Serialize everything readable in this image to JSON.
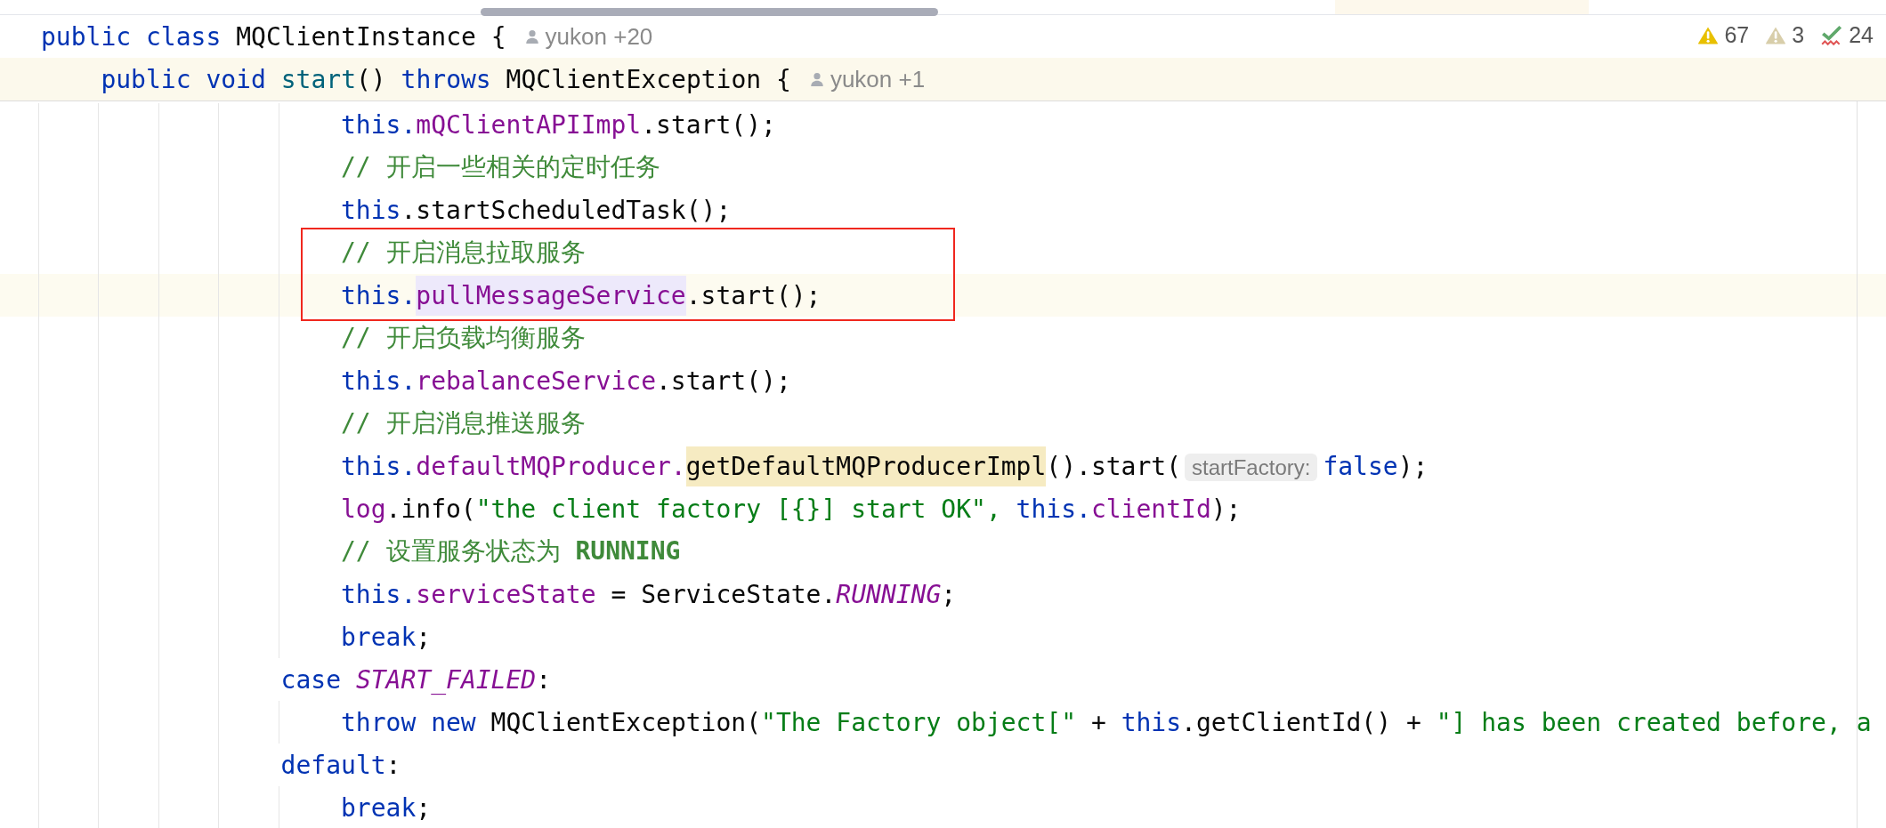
{
  "sticky_lines": [
    {
      "current": false,
      "tokens": [
        {
          "t": "public ",
          "kind": "keyword"
        },
        {
          "t": "class ",
          "kind": "keyword"
        },
        {
          "t": "MQClientInstance {",
          "kind": "plain"
        }
      ],
      "author": "yukon +20"
    },
    {
      "current": true,
      "tokens": [
        {
          "t": "public ",
          "kind": "keyword"
        },
        {
          "t": "void ",
          "kind": "keyword"
        },
        {
          "t": "start",
          "kind": "method"
        },
        {
          "t": "() ",
          "kind": "plain"
        },
        {
          "t": "throws ",
          "kind": "keyword"
        },
        {
          "t": "MQClientException {",
          "kind": "plain"
        }
      ],
      "author": "yukon +1"
    }
  ],
  "inspections": [
    {
      "kind": "warning",
      "count": "67"
    },
    {
      "kind": "weak-warning",
      "count": "3"
    },
    {
      "kind": "typo",
      "count": "24"
    }
  ],
  "code": [
    {
      "children": [
        {
          "current": false,
          "tokens": [
            {
              "t": "this.",
              "kind": "keyword"
            },
            {
              "t": "mQClientAPIImpl",
              "kind": "field"
            },
            {
              "t": ".start();",
              "kind": "plain"
            }
          ]
        },
        {
          "current": false,
          "tokens": [
            {
              "t": "// 开启一些相关的定时任务",
              "kind": "comment"
            }
          ]
        },
        {
          "current": false,
          "tokens": [
            {
              "t": "this",
              "kind": "keyword"
            },
            {
              "t": ".startScheduledTask();",
              "kind": "plain"
            }
          ]
        },
        {
          "kind": "frame",
          "lines": [
            {
              "current": false,
              "tokens": [
                {
                  "t": "// 开启消息拉取服务",
                  "kind": "comment"
                }
              ]
            },
            {
              "current": true,
              "tokens": [
                {
                  "t": "this.",
                  "kind": "keyword"
                },
                {
                  "t": "pullMessageService",
                  "kind": "usage"
                },
                {
                  "t": ".start();",
                  "kind": "plain"
                }
              ]
            }
          ]
        },
        {
          "current": false,
          "tokens": [
            {
              "t": "// 开启负载均衡服务",
              "kind": "comment"
            }
          ]
        },
        {
          "current": false,
          "tokens": [
            {
              "t": "this.",
              "kind": "keyword"
            },
            {
              "t": "rebalanceService",
              "kind": "field"
            },
            {
              "t": ".start();",
              "kind": "plain"
            }
          ]
        },
        {
          "current": false,
          "tokens": [
            {
              "t": "// 开启消息推送服务",
              "kind": "comment"
            }
          ]
        },
        {
          "current": false,
          "tokens": [
            {
              "t": "this.",
              "kind": "keyword"
            },
            {
              "t": "defaultMQProducer.",
              "kind": "field"
            },
            {
              "t": "getDefaultMQProducerImpl",
              "kind": "match"
            },
            {
              "t": "().start(",
              "kind": "plain"
            },
            {
              "t": "startFactory:",
              "kind": "hint"
            },
            {
              "t": "false",
              "kind": "keyword"
            },
            {
              "t": ");",
              "kind": "plain"
            }
          ]
        },
        {
          "current": false,
          "tokens": [
            {
              "t": "log",
              "kind": "field"
            },
            {
              "t": ".info(",
              "kind": "plain"
            },
            {
              "t": "\"the client factory [{}] start OK\", ",
              "kind": "string"
            },
            {
              "t": "this.",
              "kind": "keyword"
            },
            {
              "t": "clientId",
              "kind": "field"
            },
            {
              "t": ");",
              "kind": "plain"
            }
          ]
        },
        {
          "current": false,
          "tokens": [
            {
              "t": "// 设置服务状态为 **RUNNING**",
              "kind": "comment"
            }
          ]
        },
        {
          "current": false,
          "tokens": [
            {
              "t": "this.",
              "kind": "keyword"
            },
            {
              "t": "serviceState",
              "kind": "field"
            },
            {
              "t": " = ServiceState.",
              "kind": "plain"
            },
            {
              "t": "RUNNING",
              "kind": "constant"
            },
            {
              "t": ";",
              "kind": "plain"
            }
          ]
        },
        {
          "current": false,
          "tokens": [
            {
              "t": "break",
              "kind": "keyword"
            },
            {
              "t": ";",
              "kind": "plain"
            }
          ]
        }
      ]
    },
    {
      "current": false,
      "tokens": [
        {
          "t": "case ",
          "kind": "keyword"
        },
        {
          "t": "START_FAILED",
          "kind": "constant"
        },
        {
          "t": ":",
          "kind": "plain"
        }
      ],
      "children": [
        {
          "current": false,
          "tokens": [
            {
              "t": "throw ",
              "kind": "keyword"
            },
            {
              "t": "new ",
              "kind": "keyword"
            },
            {
              "t": "MQClientException(",
              "kind": "plain"
            },
            {
              "t": "\"The Factory object[\"",
              "kind": "string"
            },
            {
              "t": " + ",
              "kind": "plain"
            },
            {
              "t": "this",
              "kind": "keyword"
            },
            {
              "t": ".getClientId() + ",
              "kind": "plain"
            },
            {
              "t": "\"] has been created before, a",
              "kind": "string"
            }
          ]
        }
      ]
    },
    {
      "current": false,
      "tokens": [
        {
          "t": "default",
          "kind": "keyword"
        },
        {
          "t": ":",
          "kind": "plain"
        }
      ],
      "children": [
        {
          "current": false,
          "tokens": [
            {
              "t": "break",
              "kind": "keyword"
            },
            {
              "t": ";",
              "kind": "plain"
            }
          ]
        }
      ]
    }
  ]
}
